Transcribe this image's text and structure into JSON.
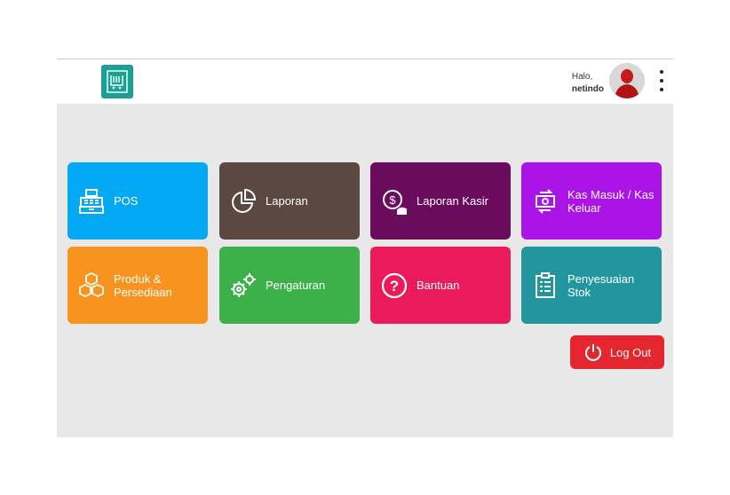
{
  "header": {
    "greeting": "Halo,",
    "username": "netindo",
    "brand_color": "#1f9e95"
  },
  "tiles": [
    {
      "label": "POS",
      "color": "#03a9f4",
      "icon": "cash-register-icon"
    },
    {
      "label": "Laporan",
      "color": "#5a4841",
      "icon": "pie-chart-icon"
    },
    {
      "label": "Laporan Kasir",
      "color": "#6a0b5e",
      "icon": "dollar-hand-icon"
    },
    {
      "label": "Kas Masuk / Kas Keluar",
      "color": "#aa14e6",
      "icon": "money-exchange-icon"
    },
    {
      "label": "Produk & Persediaan",
      "color": "#f7931e",
      "icon": "boxes-icon"
    },
    {
      "label": "Pengaturan",
      "color": "#3cb14a",
      "icon": "gears-icon"
    },
    {
      "label": "Bantuan",
      "color": "#ea1a5c",
      "icon": "help-icon"
    },
    {
      "label": "Penyesuaian Stok",
      "color": "#22969f",
      "icon": "clipboard-list-icon"
    }
  ],
  "logout": {
    "label": "Log Out",
    "color": "#e4262f",
    "icon": "power-icon"
  }
}
